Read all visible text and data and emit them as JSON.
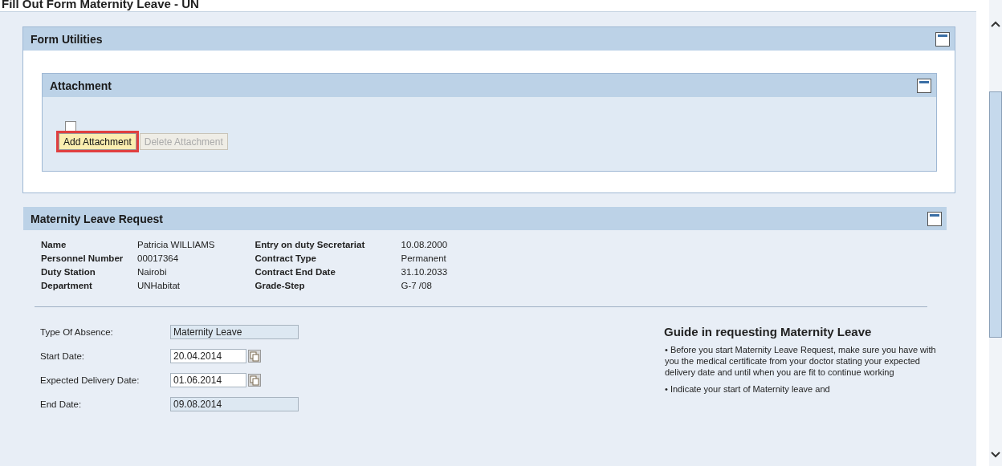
{
  "page_title": "Fill Out Form Maternity Leave - UN",
  "form_utilities": {
    "title": "Form Utilities",
    "expanded": true,
    "attachment": {
      "title": "Attachment",
      "expanded": true,
      "checkbox": {
        "checked": false
      },
      "buttons": [
        {
          "label": "Add Attachment",
          "disabled": false,
          "highlighted": true
        },
        {
          "label": "Delete Attachment",
          "disabled": true,
          "highlighted": false
        }
      ]
    }
  },
  "request": {
    "title": "Maternity Leave Request",
    "expanded": true,
    "info_left": [
      {
        "label": "Name",
        "value": "Patricia WILLIAMS"
      },
      {
        "label": "Personnel Number",
        "value": "00017364"
      },
      {
        "label": "Duty Station",
        "value": "Nairobi"
      },
      {
        "label": "Department",
        "value": "UNHabitat"
      }
    ],
    "info_right": [
      {
        "label": "Entry on duty Secretariat",
        "value": "10.08.2000"
      },
      {
        "label": "Contract Type",
        "value": "Permanent"
      },
      {
        "label": "Contract End Date",
        "value": "31.10.2033"
      },
      {
        "label": "Grade-Step",
        "value": "G-7 /08"
      }
    ],
    "fields": [
      {
        "label": "Type Of Absence:",
        "value": "Maternity Leave",
        "kind": "readonly"
      },
      {
        "label": "Start Date:",
        "value": "20.04.2014",
        "kind": "date"
      },
      {
        "label": "Expected Delivery Date:",
        "value": "01.06.2014",
        "kind": "date"
      },
      {
        "label": "End Date:",
        "value": "09.08.2014",
        "kind": "readonly"
      }
    ],
    "guide": {
      "title": "Guide in requesting Maternity Leave",
      "bullets": [
        "• Before you start Maternity Leave Request, make sure you have with you the medical certificate from your doctor stating your expected delivery date and until when you are fit to continue working",
        "• Indicate your start of Maternity leave and"
      ]
    }
  }
}
